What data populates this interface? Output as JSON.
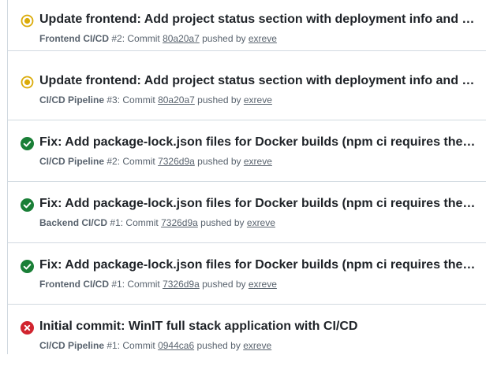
{
  "runs": [
    {
      "status": "in-progress",
      "title": "Update frontend: Add project status section with deployment info and live stats",
      "workflow": "Frontend CI/CD",
      "run_number": "#2",
      "commit_label": "Commit",
      "sha": "80a20a7",
      "pushed_by_label": "pushed by",
      "author": "exreve"
    },
    {
      "status": "in-progress",
      "title": "Update frontend: Add project status section with deployment info and live stats",
      "workflow": "CI/CD Pipeline",
      "run_number": "#3",
      "commit_label": "Commit",
      "sha": "80a20a7",
      "pushed_by_label": "pushed by",
      "author": "exreve"
    },
    {
      "status": "success",
      "title": "Fix: Add package-lock.json files for Docker builds (npm ci requires them)",
      "workflow": "CI/CD Pipeline",
      "run_number": "#2",
      "commit_label": "Commit",
      "sha": "7326d9a",
      "pushed_by_label": "pushed by",
      "author": "exreve"
    },
    {
      "status": "success",
      "title": "Fix: Add package-lock.json files for Docker builds (npm ci requires them)",
      "workflow": "Backend CI/CD",
      "run_number": "#1",
      "commit_label": "Commit",
      "sha": "7326d9a",
      "pushed_by_label": "pushed by",
      "author": "exreve"
    },
    {
      "status": "success",
      "title": "Fix: Add package-lock.json files for Docker builds (npm ci requires them)",
      "workflow": "Frontend CI/CD",
      "run_number": "#1",
      "commit_label": "Commit",
      "sha": "7326d9a",
      "pushed_by_label": "pushed by",
      "author": "exreve"
    },
    {
      "status": "failure",
      "title": "Initial commit: WinIT full stack application with CI/CD",
      "workflow": "CI/CD Pipeline",
      "run_number": "#1",
      "commit_label": "Commit",
      "sha": "0944ca6",
      "pushed_by_label": "pushed by",
      "author": "exreve"
    }
  ],
  "colors": {
    "in_progress": "#dbab09",
    "success": "#1a7f37",
    "failure": "#d1242f",
    "border": "#d1d9e0",
    "title": "#1f2328",
    "meta": "#59636e"
  }
}
